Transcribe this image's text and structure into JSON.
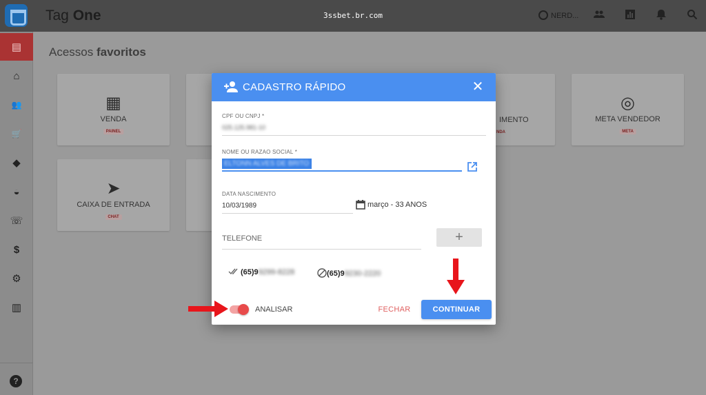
{
  "app": {
    "title_light": "Tag ",
    "title_bold": "One",
    "url": "3ssbet.br.com",
    "user_name": "NERD..."
  },
  "topbar_icons": [
    "users-icon",
    "chart-icon",
    "bell-icon",
    "search-icon"
  ],
  "sidebar": {
    "items": [
      {
        "icon": "chat-icon",
        "glyph": "▤",
        "active": true
      },
      {
        "icon": "home-icon",
        "glyph": "⌂"
      },
      {
        "icon": "users-icon",
        "glyph": "👥"
      },
      {
        "icon": "cart-icon",
        "glyph": "🛒"
      },
      {
        "icon": "tag-icon",
        "glyph": "◆"
      },
      {
        "icon": "basket-icon",
        "glyph": "◒"
      },
      {
        "icon": "voice-icon",
        "glyph": "☏"
      },
      {
        "icon": "dollar-icon",
        "glyph": "$"
      },
      {
        "icon": "gear-icon",
        "glyph": "⚙"
      },
      {
        "icon": "chart-icon",
        "glyph": "▥"
      }
    ],
    "help_glyph": "?"
  },
  "main": {
    "title_light": "Acessos ",
    "title_bold": "favoritos",
    "tiles": [
      {
        "label": "VENDA",
        "badge": "PAINEL",
        "glyph": "▦"
      },
      {
        "label": "CAIXA DE ENTRADA",
        "badge": "CHAT",
        "glyph": "➤"
      },
      {
        "label": "META VENDEDOR",
        "badge": "META",
        "glyph": "◎"
      }
    ],
    "partial_tile_label": "IMENTO",
    "partial_tile_badge": "NDA"
  },
  "modal": {
    "title": "CADASTRO RÁPIDO",
    "close_glyph": "✕",
    "cpf_label": "CPF OU CNPJ *",
    "cpf_value": "025.125.981-10",
    "name_label": "NOME OU RAZAO SOCIAL *",
    "name_value": "ELTONN ALVES DE BRITO",
    "birth_label": "DATA NASCIMENTO",
    "birth_value": "10/03/1989",
    "age_text": "março - 33 ANOS",
    "phone_placeholder": "TELEFONE",
    "add_glyph": "+",
    "phones": [
      {
        "prefix": "(65)9",
        "rest": "9299-8228",
        "status": "verified"
      },
      {
        "prefix": "(65)9",
        "rest": "9230-2220",
        "status": "blocked"
      }
    ],
    "toggle_label": "ANALISAR",
    "toggle_on": true,
    "cancel_label": "FECHAR",
    "confirm_label": "CONTINUAR"
  },
  "colors": {
    "accent": "#4a8ff0",
    "danger": "#e84b4b",
    "annotation": "#e8151b"
  }
}
